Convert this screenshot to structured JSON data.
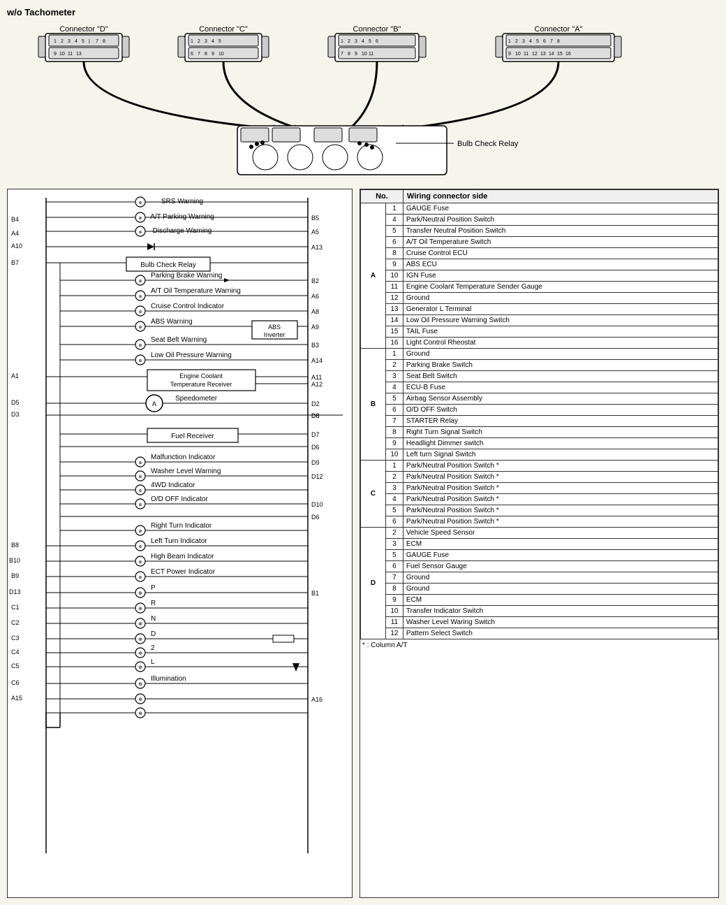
{
  "title": "w/o Tachometer",
  "connectors": [
    {
      "label": "Connector \"D\"",
      "pins": "1 2 3 4 5 | 7 8 9 10 11 13"
    },
    {
      "label": "Connector \"C\"",
      "pins": "1 2 3 4 5 6 7 8 9 10"
    },
    {
      "label": "Connector \"B\"",
      "pins": "1 2 3 4 5 6 7 8 9 10 11"
    },
    {
      "label": "Connector \"A\"",
      "pins": "1 2 3 4 5 6 7 8 | 9 10 11 12 13 14 15 16"
    }
  ],
  "bulb_check_relay_label": "Bulb Check Relay",
  "wiring_rows": [
    {
      "left": "",
      "component": "SRS Warning",
      "right": ""
    },
    {
      "left": "B4",
      "component": "A/T Parking Warning",
      "right": "B5"
    },
    {
      "left": "A4",
      "component": "Discharge Warning",
      "right": "A5"
    },
    {
      "left": "A10",
      "component": "",
      "right": "A13"
    },
    {
      "left": "B7",
      "component": "Bulb Check Relay",
      "right": ""
    },
    {
      "left": "",
      "component": "Parking Brake Warning",
      "right": "B2"
    },
    {
      "left": "",
      "component": "A/T Oil Temperature Warning",
      "right": "A6"
    },
    {
      "left": "",
      "component": "Cruise Control Indicator",
      "right": "A8"
    },
    {
      "left": "",
      "component": "ABS Warning",
      "right": ""
    },
    {
      "left": "",
      "component": "ABS Inverter",
      "right": "A9"
    },
    {
      "left": "",
      "component": "Seat Belt Warning",
      "right": "B3"
    },
    {
      "left": "",
      "component": "Low Oil Pressure Warning",
      "right": "A14"
    },
    {
      "left": "A1",
      "component": "Engine Coolant Temperature Receiver",
      "right": "A11"
    },
    {
      "left": "",
      "component": "",
      "right": "A12"
    },
    {
      "left": "D5",
      "component": "Speedometer",
      "right": "D2"
    },
    {
      "left": "D3",
      "component": "",
      "right": "D8"
    },
    {
      "left": "",
      "component": "Fuel Receiver",
      "right": "D7"
    },
    {
      "left": "",
      "component": "",
      "right": "D6"
    },
    {
      "left": "",
      "component": "Malfunction Indicator",
      "right": "D9"
    },
    {
      "left": "",
      "component": "Washer Level Warning",
      "right": "D12"
    },
    {
      "left": "",
      "component": "4WD Indicator",
      "right": ""
    },
    {
      "left": "",
      "component": "O/D OFF Indicator",
      "right": "D10"
    },
    {
      "left": "",
      "component": "",
      "right": "D6"
    },
    {
      "left": "",
      "component": "Right Turn Indicator",
      "right": ""
    },
    {
      "left": "B8",
      "component": "Left Turn Indicator",
      "right": ""
    },
    {
      "left": "B10",
      "component": "High Beam Indicator",
      "right": ""
    },
    {
      "left": "B9",
      "component": "ECT Power Indicator",
      "right": ""
    },
    {
      "left": "D13",
      "component": "P",
      "right": "B1"
    },
    {
      "left": "C1",
      "component": "R",
      "right": ""
    },
    {
      "left": "C2",
      "component": "N",
      "right": ""
    },
    {
      "left": "C3",
      "component": "D",
      "right": ""
    },
    {
      "left": "C4",
      "component": "2",
      "right": ""
    },
    {
      "left": "C5",
      "component": "L",
      "right": ""
    },
    {
      "left": "C6",
      "component": "Illumination",
      "right": ""
    },
    {
      "left": "A15",
      "component": "",
      "right": "A16"
    },
    {
      "left": "",
      "component": "",
      "right": ""
    }
  ],
  "table": {
    "headers": [
      "No.",
      "Wiring connector side"
    ],
    "sections": [
      {
        "section": "A",
        "rows": [
          {
            "num": "1",
            "desc": "GAUGE Fuse"
          },
          {
            "num": "4",
            "desc": "Park/Neutral Position Switch"
          },
          {
            "num": "5",
            "desc": "Transfer Neutral Position Switch"
          },
          {
            "num": "6",
            "desc": "A/T Oil Temperature Switch"
          },
          {
            "num": "8",
            "desc": "Cruise Control ECU"
          },
          {
            "num": "9",
            "desc": "ABS ECU"
          },
          {
            "num": "10",
            "desc": "IGN Fuse"
          },
          {
            "num": "11",
            "desc": "Engine Coolant Temperature Sender Gauge"
          },
          {
            "num": "12",
            "desc": "Ground"
          },
          {
            "num": "13",
            "desc": "Generator L Terminal"
          },
          {
            "num": "14",
            "desc": "Low Oil Pressure Warning Switch"
          },
          {
            "num": "15",
            "desc": "TAIL Fuse"
          },
          {
            "num": "16",
            "desc": "Light Control Rheostat"
          }
        ]
      },
      {
        "section": "B",
        "rows": [
          {
            "num": "1",
            "desc": "Ground"
          },
          {
            "num": "2",
            "desc": "Parking Brake Switch"
          },
          {
            "num": "3",
            "desc": "Seat Belt Switch"
          },
          {
            "num": "4",
            "desc": "ECU-B Fuse"
          },
          {
            "num": "5",
            "desc": "Airbag Sensor Assembly"
          },
          {
            "num": "6",
            "desc": "O/D OFF Switch"
          },
          {
            "num": "7",
            "desc": "STARTER Relay"
          },
          {
            "num": "8",
            "desc": "Right Turn Signal Switch"
          },
          {
            "num": "9",
            "desc": "Headlight Dimmer switch"
          },
          {
            "num": "10",
            "desc": "Left turn Signal Switch"
          }
        ]
      },
      {
        "section": "C",
        "rows": [
          {
            "num": "1",
            "desc": "Park/Neutral Position Switch *"
          },
          {
            "num": "2",
            "desc": "Park/Neutral Position Switch *"
          },
          {
            "num": "3",
            "desc": "Park/Neutral Position Switch *"
          },
          {
            "num": "4",
            "desc": "Park/Neutral Position Switch *"
          },
          {
            "num": "5",
            "desc": "Park/Neutral Position Switch *"
          },
          {
            "num": "6",
            "desc": "Park/Neutral Position Switch *"
          }
        ]
      },
      {
        "section": "D",
        "rows": [
          {
            "num": "2",
            "desc": "Vehicle Speed Sensor"
          },
          {
            "num": "3",
            "desc": "ECM"
          },
          {
            "num": "5",
            "desc": "GAUGE Fuse"
          },
          {
            "num": "6",
            "desc": "Fuel Sensor Gauge"
          },
          {
            "num": "7",
            "desc": "Ground"
          },
          {
            "num": "8",
            "desc": "Ground"
          },
          {
            "num": "9",
            "desc": "ECM"
          },
          {
            "num": "10",
            "desc": "Transfer Indicator Switch"
          },
          {
            "num": "11",
            "desc": "Washer Level Waring Switch"
          },
          {
            "num": "12",
            "desc": "Pattern Select Switch"
          }
        ]
      }
    ],
    "note": "* : Column A/T"
  }
}
